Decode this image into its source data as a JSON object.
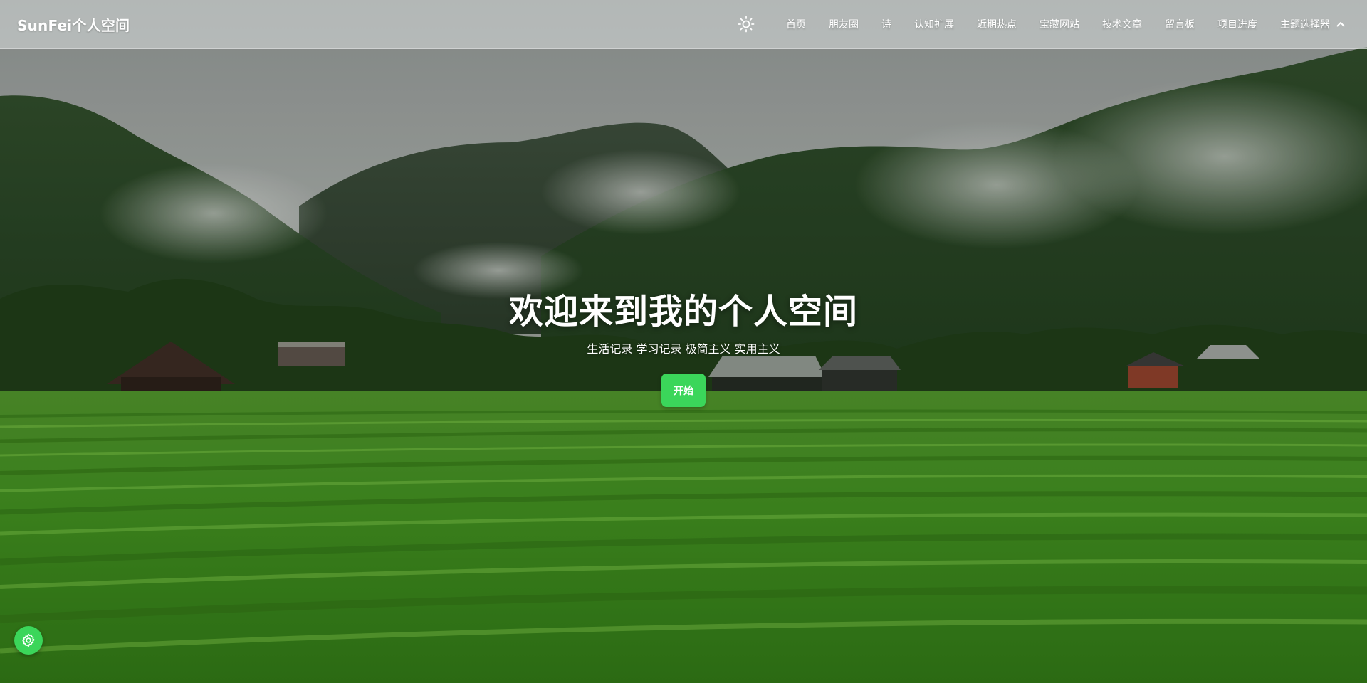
{
  "header": {
    "brand": "SunFei个人空间",
    "theme_toggle_icon": "sun-icon",
    "nav": [
      {
        "label": "首页"
      },
      {
        "label": "朋友圈"
      },
      {
        "label": "诗"
      },
      {
        "label": "认知扩展"
      },
      {
        "label": "近期热点"
      },
      {
        "label": "宝藏网站"
      },
      {
        "label": "技术文章"
      },
      {
        "label": "留言板"
      },
      {
        "label": "项目进度"
      },
      {
        "label": "主题选择器",
        "icon": "chevron-up-icon"
      }
    ]
  },
  "hero": {
    "title": "欢迎来到我的个人空间",
    "subtitle": "生活记录 学习记录 极简主义 实用主义",
    "start_label": "开始"
  },
  "floating": {
    "settings_icon": "gear-icon"
  },
  "colors": {
    "accent": "#3bd65a",
    "navbar_bg": "rgba(220,224,224,0.55)",
    "text": "#ffffff"
  }
}
